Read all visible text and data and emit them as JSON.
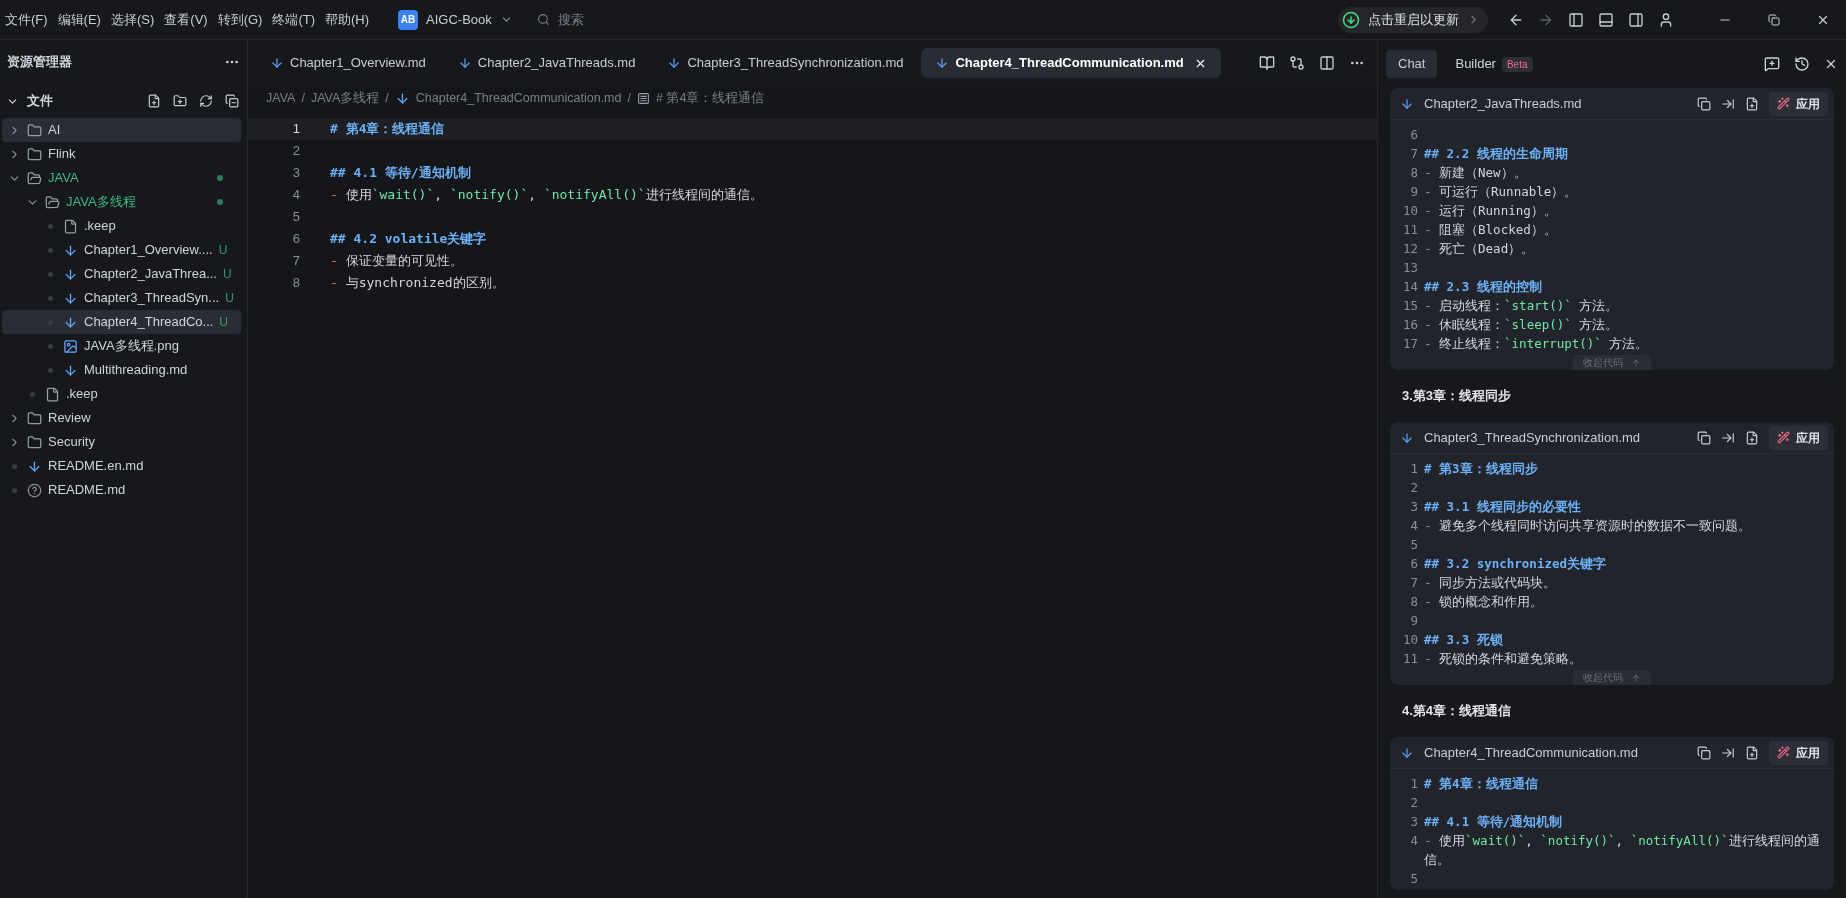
{
  "menu": [
    "文件(F)",
    "编辑(E)",
    "选择(S)",
    "查看(V)",
    "转到(G)",
    "终端(T)",
    "帮助(H)"
  ],
  "project": {
    "badge": "AB",
    "name": "AIGC-Book"
  },
  "search": {
    "placeholder": "搜索"
  },
  "update_button": "点击重启以更新",
  "sidebar": {
    "title": "资源管理器",
    "section": "文件",
    "tree": [
      {
        "name": "AI",
        "kind": "folder",
        "expanded": false,
        "selected": true,
        "modified": false
      },
      {
        "name": "Flink",
        "kind": "folder",
        "expanded": false,
        "selected": false,
        "modified": false
      },
      {
        "name": "JAVA",
        "kind": "folder",
        "expanded": true,
        "selected": false,
        "modified": true,
        "children": [
          {
            "name": "JAVA多线程",
            "kind": "folder",
            "expanded": true,
            "selected": false,
            "modified": true,
            "children": [
              {
                "name": ".keep",
                "kind": "file",
                "selected": false
              },
              {
                "name": "Chapter1_Overview....",
                "kind": "markdown",
                "selected": false,
                "badge": "U"
              },
              {
                "name": "Chapter2_JavaThrea...",
                "kind": "markdown",
                "selected": false,
                "badge": "U"
              },
              {
                "name": "Chapter3_ThreadSyn...",
                "kind": "markdown",
                "selected": false,
                "badge": "U"
              },
              {
                "name": "Chapter4_ThreadCo...",
                "kind": "markdown",
                "selected": true,
                "badge": "U"
              },
              {
                "name": "JAVA多线程.png",
                "kind": "image",
                "selected": false
              },
              {
                "name": "Multithreading.md",
                "kind": "markdown",
                "selected": false
              }
            ]
          },
          {
            "name": ".keep",
            "kind": "file",
            "selected": false
          }
        ]
      },
      {
        "name": "Review",
        "kind": "folder",
        "expanded": false,
        "selected": false,
        "modified": false
      },
      {
        "name": "Security",
        "kind": "folder",
        "expanded": false,
        "selected": false,
        "modified": false
      },
      {
        "name": "README.en.md",
        "kind": "markdown",
        "selected": false
      },
      {
        "name": "README.md",
        "kind": "info",
        "selected": false
      }
    ]
  },
  "editor": {
    "tabs": [
      {
        "label": "Chapter1_Overview.md",
        "selected": false
      },
      {
        "label": "Chapter2_JavaThreads.md",
        "selected": false
      },
      {
        "label": "Chapter3_ThreadSynchronization.md",
        "selected": false
      },
      {
        "label": "Chapter4_ThreadCommunication.md",
        "selected": true
      }
    ],
    "breadcrumb_separator": "/",
    "breadcrumb": [
      {
        "text": "JAVA",
        "kind": "folder"
      },
      {
        "text": "JAVA多线程",
        "kind": "folder"
      },
      {
        "text": "Chapter4_ThreadCommunication.md",
        "kind": "markdown"
      },
      {
        "text": "# 第4章：线程通信",
        "kind": "symbol"
      }
    ],
    "lines": [
      {
        "number": "1",
        "kind": "heading",
        "current": true,
        "text": "# 第4章：线程通信"
      },
      {
        "number": "2",
        "kind": "blank",
        "current": false
      },
      {
        "number": "3",
        "kind": "heading",
        "current": false,
        "text": "## 4.1 等待/通知机制"
      },
      {
        "number": "4",
        "kind": "item",
        "current": false,
        "marker": "-",
        "parts": [
          {
            "kind": "text",
            "text": "使用"
          },
          {
            "kind": "code",
            "text": "`wait()`"
          },
          {
            "kind": "text",
            "text": ", "
          },
          {
            "kind": "code",
            "text": "`notify()`"
          },
          {
            "kind": "text",
            "text": ", "
          },
          {
            "kind": "code",
            "text": "`notifyAll()`"
          },
          {
            "kind": "text",
            "text": "进行线程间的通信。"
          }
        ]
      },
      {
        "number": "5",
        "kind": "blank",
        "current": false
      },
      {
        "number": "6",
        "kind": "heading",
        "current": false,
        "text": "## 4.2 volatile关键字"
      },
      {
        "number": "7",
        "kind": "item",
        "current": false,
        "marker": "-",
        "parts": [
          {
            "kind": "text",
            "text": "保证变量的可见性。"
          }
        ]
      },
      {
        "number": "8",
        "kind": "item",
        "current": false,
        "marker": "-",
        "parts": [
          {
            "kind": "text",
            "text": "与synchronized的区别。"
          }
        ]
      }
    ]
  },
  "chat": {
    "tabs": [
      {
        "label": "Chat",
        "selected": true
      },
      {
        "label": "Builder",
        "selected": false,
        "badge": "Beta"
      }
    ],
    "blocks": [
      {
        "kind": "card",
        "file": "Chapter2_JavaThreads.md",
        "apply": "应用",
        "collapse": "收起代码",
        "lines": [
          {
            "number": "6",
            "kind": "blank"
          },
          {
            "number": "7",
            "kind": "heading",
            "text": "## 2.2 线程的生命周期"
          },
          {
            "number": "8",
            "kind": "item",
            "marker": "-",
            "parts": [
              {
                "kind": "text",
                "text": "新建（New）。"
              }
            ]
          },
          {
            "number": "9",
            "kind": "item",
            "marker": "-",
            "parts": [
              {
                "kind": "text",
                "text": "可运行（Runnable）。"
              }
            ]
          },
          {
            "number": "10",
            "kind": "item",
            "marker": "-",
            "parts": [
              {
                "kind": "text",
                "text": "运行（Running）。"
              }
            ]
          },
          {
            "number": "11",
            "kind": "item",
            "marker": "-",
            "parts": [
              {
                "kind": "text",
                "text": "阻塞（Blocked）。"
              }
            ]
          },
          {
            "number": "12",
            "kind": "item",
            "marker": "-",
            "parts": [
              {
                "kind": "text",
                "text": "死亡（Dead）。"
              }
            ]
          },
          {
            "number": "13",
            "kind": "blank"
          },
          {
            "number": "14",
            "kind": "heading",
            "text": "## 2.3 线程的控制"
          },
          {
            "number": "15",
            "kind": "item",
            "marker": "-",
            "parts": [
              {
                "kind": "text",
                "text": "启动线程："
              },
              {
                "kind": "code",
                "text": "`start()`"
              },
              {
                "kind": "text",
                "text": " 方法。"
              }
            ]
          },
          {
            "number": "16",
            "kind": "item",
            "marker": "-",
            "parts": [
              {
                "kind": "text",
                "text": "休眠线程："
              },
              {
                "kind": "code",
                "text": "`sleep()`"
              },
              {
                "kind": "text",
                "text": " 方法。"
              }
            ]
          },
          {
            "number": "17",
            "kind": "item",
            "marker": "-",
            "parts": [
              {
                "kind": "text",
                "text": "终止线程："
              },
              {
                "kind": "code",
                "text": "`interrupt()`"
              },
              {
                "kind": "text",
                "text": " 方法。"
              }
            ]
          }
        ]
      },
      {
        "kind": "heading",
        "text": "3.第3章：线程同步"
      },
      {
        "kind": "card",
        "file": "Chapter3_ThreadSynchronization.md",
        "apply": "应用",
        "collapse": "收起代码",
        "lines": [
          {
            "number": "1",
            "kind": "heading",
            "text": "# 第3章：线程同步"
          },
          {
            "number": "2",
            "kind": "blank"
          },
          {
            "number": "3",
            "kind": "heading",
            "text": "## 3.1 线程同步的必要性"
          },
          {
            "number": "4",
            "kind": "item",
            "marker": "-",
            "parts": [
              {
                "kind": "text",
                "text": "避免多个线程同时访问共享资源时的数据不一致问题。"
              }
            ]
          },
          {
            "number": "5",
            "kind": "blank"
          },
          {
            "number": "6",
            "kind": "heading",
            "text": "## 3.2 synchronized关键字"
          },
          {
            "number": "7",
            "kind": "item",
            "marker": "-",
            "parts": [
              {
                "kind": "text",
                "text": "同步方法或代码块。"
              }
            ]
          },
          {
            "number": "8",
            "kind": "item",
            "marker": "-",
            "parts": [
              {
                "kind": "text",
                "text": "锁的概念和作用。"
              }
            ]
          },
          {
            "number": "9",
            "kind": "blank"
          },
          {
            "number": "10",
            "kind": "heading",
            "text": "## 3.3 死锁"
          },
          {
            "number": "11",
            "kind": "item",
            "marker": "-",
            "parts": [
              {
                "kind": "text",
                "text": "死锁的条件和避免策略。"
              }
            ]
          }
        ]
      },
      {
        "kind": "heading",
        "text": "4.第4章：线程通信"
      },
      {
        "kind": "card",
        "file": "Chapter4_ThreadCommunication.md",
        "apply": "应用",
        "lines": [
          {
            "number": "1",
            "kind": "heading",
            "text": "# 第4章：线程通信"
          },
          {
            "number": "2",
            "kind": "blank"
          },
          {
            "number": "3",
            "kind": "heading",
            "text": "## 4.1 等待/通知机制"
          },
          {
            "number": "4",
            "kind": "item",
            "marker": "-",
            "parts": [
              {
                "kind": "text",
                "text": "使用"
              },
              {
                "kind": "code",
                "text": "`wait()`"
              },
              {
                "kind": "text",
                "text": ", "
              },
              {
                "kind": "code",
                "text": "`notify()`"
              },
              {
                "kind": "text",
                "text": ", "
              },
              {
                "kind": "code",
                "text": "`notifyAll()`"
              },
              {
                "kind": "text",
                "text": "进行线程间的通信。"
              }
            ]
          },
          {
            "number": "5",
            "kind": "blank"
          }
        ]
      }
    ]
  }
}
